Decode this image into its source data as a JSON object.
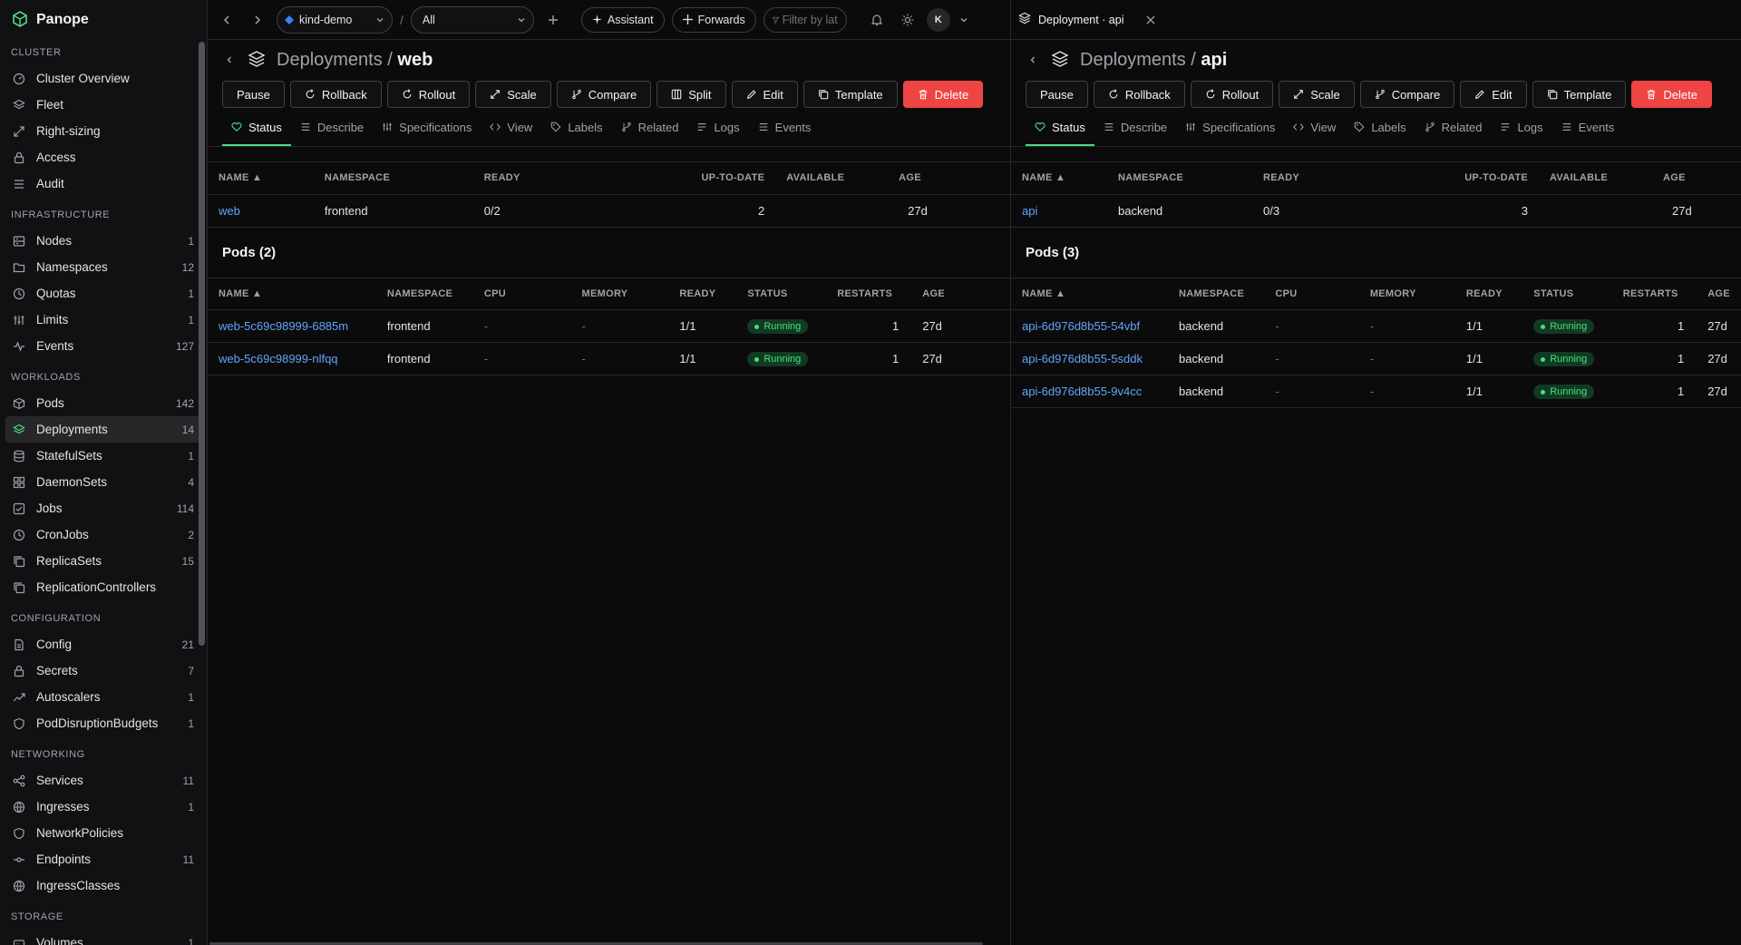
{
  "app": {
    "name": "Panope"
  },
  "sidebar": {
    "sections": [
      {
        "title": "CLUSTER",
        "items": [
          {
            "label": "Cluster Overview",
            "icon": "gauge-icon",
            "count": ""
          },
          {
            "label": "Fleet",
            "icon": "layers-icon",
            "count": ""
          },
          {
            "label": "Right-sizing",
            "icon": "resize-icon",
            "count": ""
          },
          {
            "label": "Access",
            "icon": "lock-icon",
            "count": ""
          },
          {
            "label": "Audit",
            "icon": "list-icon",
            "count": ""
          }
        ]
      },
      {
        "title": "INFRASTRUCTURE",
        "items": [
          {
            "label": "Nodes",
            "icon": "server-icon",
            "count": "1"
          },
          {
            "label": "Namespaces",
            "icon": "folder-icon",
            "count": "12"
          },
          {
            "label": "Quotas",
            "icon": "clock-icon",
            "count": "1"
          },
          {
            "label": "Limits",
            "icon": "sliders-icon",
            "count": "1"
          },
          {
            "label": "Events",
            "icon": "activity-icon",
            "count": "127"
          }
        ]
      },
      {
        "title": "WORKLOADS",
        "items": [
          {
            "label": "Pods",
            "icon": "box-icon",
            "count": "142"
          },
          {
            "label": "Deployments",
            "icon": "layers-icon",
            "count": "14",
            "active": true
          },
          {
            "label": "StatefulSets",
            "icon": "database-icon",
            "count": "1"
          },
          {
            "label": "DaemonSets",
            "icon": "grid-icon",
            "count": "4"
          },
          {
            "label": "Jobs",
            "icon": "check-square-icon",
            "count": "114"
          },
          {
            "label": "CronJobs",
            "icon": "clock-icon",
            "count": "2"
          },
          {
            "label": "ReplicaSets",
            "icon": "copy-icon",
            "count": "15"
          },
          {
            "label": "ReplicationControllers",
            "icon": "copy-icon",
            "count": ""
          }
        ]
      },
      {
        "title": "CONFIGURATION",
        "items": [
          {
            "label": "Config",
            "icon": "file-icon",
            "count": "21"
          },
          {
            "label": "Secrets",
            "icon": "lock-icon",
            "count": "7"
          },
          {
            "label": "Autoscalers",
            "icon": "trending-up-icon",
            "count": "1"
          },
          {
            "label": "PodDisruptionBudgets",
            "icon": "shield-icon",
            "count": "1"
          }
        ]
      },
      {
        "title": "NETWORKING",
        "items": [
          {
            "label": "Services",
            "icon": "share-icon",
            "count": "11"
          },
          {
            "label": "Ingresses",
            "icon": "globe-icon",
            "count": "1"
          },
          {
            "label": "NetworkPolicies",
            "icon": "shield-icon",
            "count": ""
          },
          {
            "label": "Endpoints",
            "icon": "dot-line-icon",
            "count": "11"
          },
          {
            "label": "IngressClasses",
            "icon": "globe-icon",
            "count": ""
          }
        ]
      },
      {
        "title": "STORAGE",
        "items": [
          {
            "label": "Volumes",
            "icon": "hdd-icon",
            "count": "1"
          }
        ]
      }
    ]
  },
  "topbar": {
    "context": "kind-demo",
    "separator": "/",
    "namespace": "All",
    "assistant": "Assistant",
    "forwards": "Forwards",
    "filter_placeholder": "Filter by lat",
    "avatar": "K"
  },
  "right_window": {
    "title": "Deployment · api"
  },
  "actions": [
    "Pause",
    "Rollback",
    "Rollout",
    "Scale",
    "Compare",
    "Split",
    "Edit",
    "Template",
    "Delete"
  ],
  "actions_right": [
    "Pause",
    "Rollback",
    "Rollout",
    "Scale",
    "Compare",
    "Edit",
    "Template",
    "Delete"
  ],
  "tabs": [
    "Status",
    "Describe",
    "Specifications",
    "View",
    "Labels",
    "Related",
    "Logs",
    "Events"
  ],
  "deploy_headers": [
    "NAME ▲",
    "NAMESPACE",
    "READY",
    "UP-TO-DATE",
    "AVAILABLE",
    "AGE"
  ],
  "pod_headers": [
    "NAME ▲",
    "NAMESPACE",
    "CPU",
    "MEMORY",
    "READY",
    "STATUS",
    "RESTARTS",
    "AGE"
  ],
  "left": {
    "crumb_parent": "Deployments",
    "crumb_sep": "/",
    "crumb_name": "web",
    "deployment": {
      "name": "web",
      "namespace": "frontend",
      "ready": "0/2",
      "uptodate": "2",
      "available": "",
      "age": "27d"
    },
    "pods_title": "Pods (2)",
    "pods": [
      {
        "name": "web-5c69c98999-6885m",
        "namespace": "frontend",
        "cpu": "-",
        "memory": "-",
        "ready": "1/1",
        "status": "Running",
        "restarts": "1",
        "age": "27d"
      },
      {
        "name": "web-5c69c98999-nlfqq",
        "namespace": "frontend",
        "cpu": "-",
        "memory": "-",
        "ready": "1/1",
        "status": "Running",
        "restarts": "1",
        "age": "27d"
      }
    ]
  },
  "right": {
    "crumb_parent": "Deployments",
    "crumb_sep": "/",
    "crumb_name": "api",
    "deployment": {
      "name": "api",
      "namespace": "backend",
      "ready": "0/3",
      "uptodate": "3",
      "available": "",
      "age": "27d"
    },
    "pods_title": "Pods (3)",
    "pods": [
      {
        "name": "api-6d976d8b55-54vbf",
        "namespace": "backend",
        "cpu": "-",
        "memory": "-",
        "ready": "1/1",
        "status": "Running",
        "restarts": "1",
        "age": "27d"
      },
      {
        "name": "api-6d976d8b55-5sddk",
        "namespace": "backend",
        "cpu": "-",
        "memory": "-",
        "ready": "1/1",
        "status": "Running",
        "restarts": "1",
        "age": "27d"
      },
      {
        "name": "api-6d976d8b55-9v4cc",
        "namespace": "backend",
        "cpu": "-",
        "memory": "-",
        "ready": "1/1",
        "status": "Running",
        "restarts": "1",
        "age": "27d"
      }
    ]
  },
  "colors": {
    "accent": "#4ade80",
    "link": "#60a5fa",
    "danger": "#ef4444",
    "bg": "#0b0b0c"
  }
}
